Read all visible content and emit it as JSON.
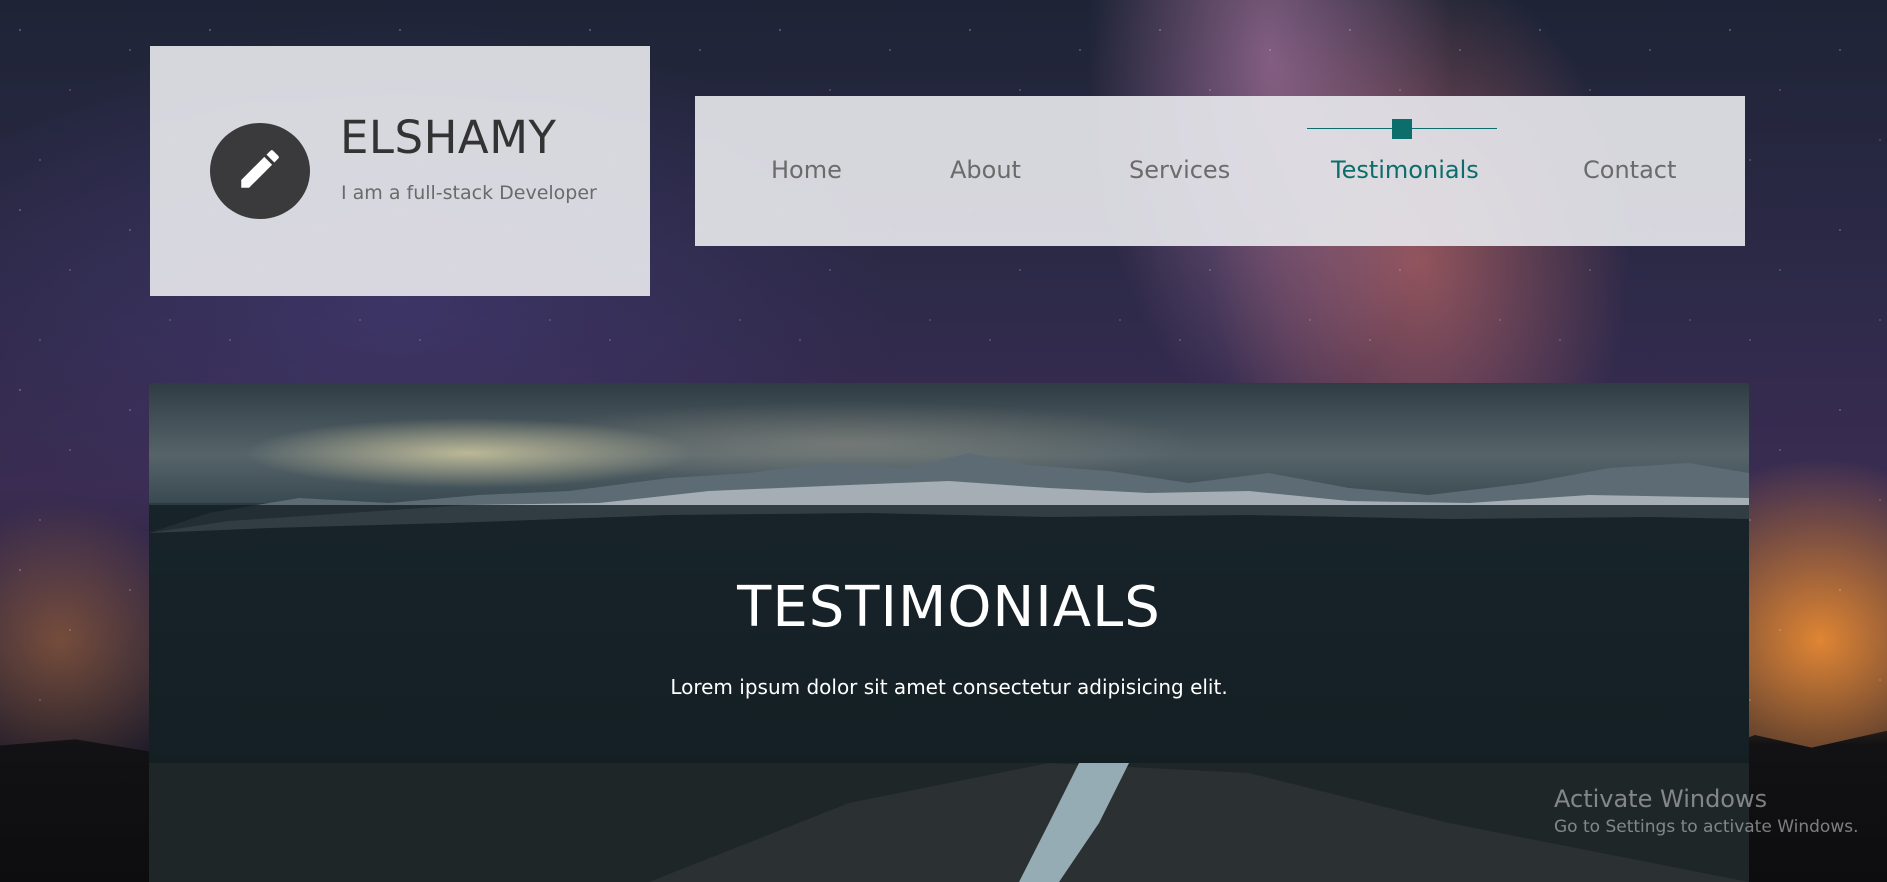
{
  "brand": {
    "name": "ELSHAMY",
    "tagline": "I am a full-stack Developer",
    "icon": "pencil-icon"
  },
  "nav": {
    "items": [
      {
        "label": "Home"
      },
      {
        "label": "About"
      },
      {
        "label": "Services"
      },
      {
        "label": "Testimonials"
      },
      {
        "label": "Contact"
      }
    ],
    "active": "Testimonials"
  },
  "hero": {
    "title": "TESTIMONIALS",
    "subtitle": "Lorem ipsum dolor sit amet consectetur adipisicing elit."
  },
  "watermark": {
    "title": "Activate Windows",
    "subtitle": "Go to Settings to activate Windows."
  },
  "colors": {
    "accent": "#0b6e6b",
    "panel": "#e4e4ea",
    "logo_circle": "#3a3a3c"
  }
}
